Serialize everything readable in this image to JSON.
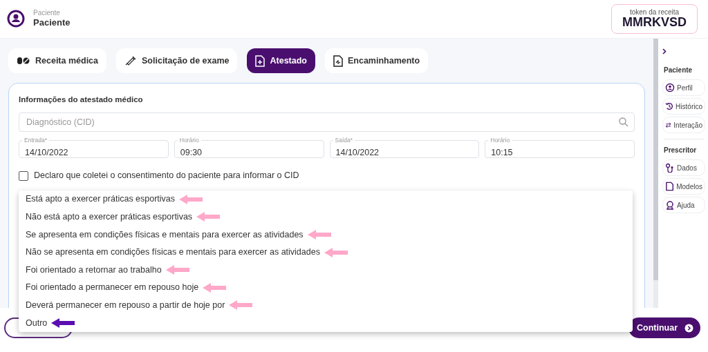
{
  "header": {
    "caption": "Paciente",
    "name": "Paciente"
  },
  "token": {
    "label": "token da receita",
    "code": "MMRKVSD"
  },
  "tabs": [
    {
      "label": "Receita médica",
      "selected": false
    },
    {
      "label": "Solicitação de exame",
      "selected": false
    },
    {
      "label": "Atestado",
      "selected": true
    },
    {
      "label": "Encaminhamento",
      "selected": false
    }
  ],
  "form": {
    "title": "Informações do atestado médico",
    "search": {
      "placeholder": "Diagnóstico (CID)"
    },
    "fields": [
      {
        "label": "Entrada*",
        "value": "14/10/2022"
      },
      {
        "label": "Horário",
        "value": "09:30"
      },
      {
        "label": "Saída*",
        "value": "14/10/2022"
      },
      {
        "label": "Horário",
        "value": "10:15"
      }
    ],
    "consent": {
      "label": "Declaro que coletei o consentimento do paciente para informar o CID",
      "checked": false
    }
  },
  "motivo_options": [
    {
      "label": "Está apto a exercer práticas esportivas",
      "color": "#ffa8c9"
    },
    {
      "label": "Não está apto a exercer práticas esportivas",
      "color": "#ffa8c9"
    },
    {
      "label": "Se apresenta em condições físicas e mentais para exercer as atividades",
      "color": "#ffa8c9"
    },
    {
      "label": "Não se apresenta em condições físicas e mentais para exercer as atividades",
      "color": "#ffa8c9"
    },
    {
      "label": "Foi orientado a retornar ao trabalho",
      "color": "#ffa8c9"
    },
    {
      "label": "Foi orientado a permanecer em repouso hoje",
      "color": "#ffa8c9"
    },
    {
      "label": "Deverá permanecer em repouso a partir de hoje por",
      "color": "#ffa8c9"
    },
    {
      "label": "Outro",
      "color": "#5b0db0"
    }
  ],
  "continue_button": "Continuar",
  "sidebar": {
    "sections": [
      {
        "title": "Paciente",
        "items": [
          "Perfil",
          "Histórico",
          "Interação"
        ]
      },
      {
        "title": "Prescritor",
        "items": [
          "Dados",
          "Modelos",
          "Ajuda"
        ]
      }
    ]
  }
}
